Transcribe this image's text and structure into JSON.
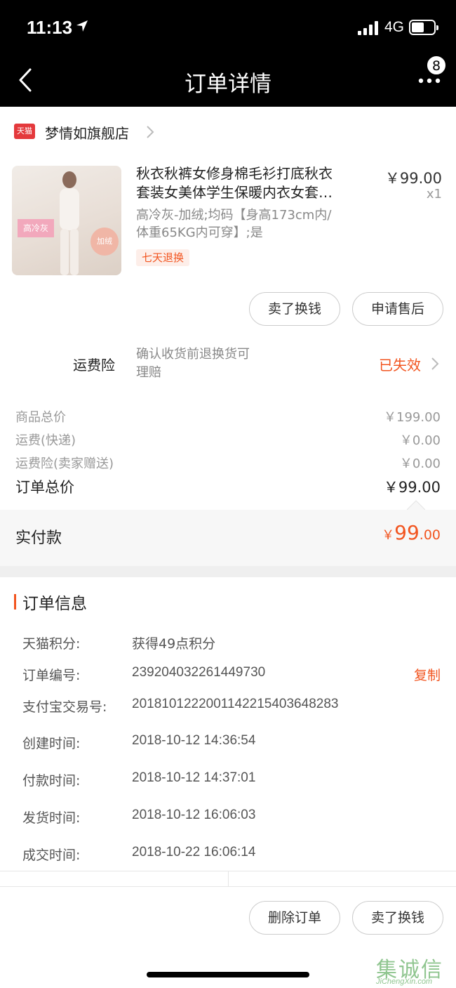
{
  "status_bar": {
    "time": "11:13",
    "network": "4G"
  },
  "nav": {
    "title": "订单详情",
    "badge_count": "8"
  },
  "store": {
    "platform_badge": "天猫",
    "name": "梦情如旗舰店"
  },
  "product": {
    "title_line1": "秋衣秋裤女修身棉毛衫打底秋衣",
    "title_line2": "套装女美体学生保暖内衣女套…",
    "spec_line1": "高冷灰-加绒;均码【身高173cm内/",
    "spec_line2": "体重65KG内可穿】;是",
    "badge": "七天退换",
    "price": "￥99.00",
    "qty": "x1",
    "image_tag1": "高冷灰",
    "image_tag2": "加绒"
  },
  "item_actions": {
    "sell": "卖了换钱",
    "after_sale": "申请售后"
  },
  "insurance": {
    "label": "运费险",
    "desc_line1": "确认收货前退换货可",
    "desc_line2": "理赔",
    "status": "已失效"
  },
  "summary": {
    "goods_total_label": "商品总价",
    "goods_total": "￥199.00",
    "shipping_label": "运费(快递)",
    "shipping": "￥0.00",
    "insurance_label": "运费险(卖家赠送)",
    "insurance": "￥0.00",
    "order_total_label": "订单总价",
    "order_total": "￥99.00"
  },
  "paid": {
    "label": "实付款",
    "currency": "￥",
    "integer": "99",
    "decimal": ".00"
  },
  "order_info": {
    "heading": "订单信息",
    "points_label": "天猫积分:",
    "points": "获得49点积分",
    "order_no_label": "订单编号:",
    "order_no": "239204032261449730",
    "copy": "复制",
    "alipay_label": "支付宝交易号:",
    "alipay_no": "2018101222001142215403648283",
    "created_label": "创建时间:",
    "created": "2018-10-12 14:36:54",
    "paid_label": "付款时间:",
    "paid_time": "2018-10-12 14:37:01",
    "shipped_label": "发货时间:",
    "shipped": "2018-10-12 16:06:03",
    "closed_label": "成交时间:",
    "closed": "2018-10-22 16:06:14"
  },
  "footer_actions": {
    "delete": "删除订单",
    "sell": "卖了换钱"
  },
  "watermark": {
    "text": "集诚信",
    "url": "JiChengXin.com"
  },
  "colors": {
    "accent": "#f25520",
    "tmall": "#e4393c"
  }
}
